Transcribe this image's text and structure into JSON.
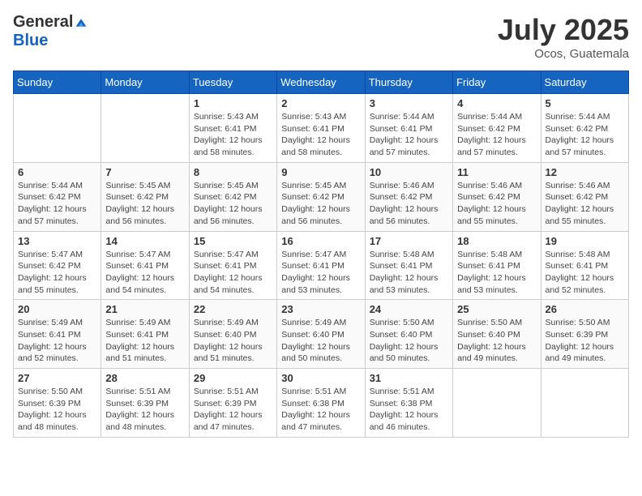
{
  "header": {
    "logo_general": "General",
    "logo_blue": "Blue",
    "month_title": "July 2025",
    "location": "Ocos, Guatemala"
  },
  "weekdays": [
    "Sunday",
    "Monday",
    "Tuesday",
    "Wednesday",
    "Thursday",
    "Friday",
    "Saturday"
  ],
  "weeks": [
    [
      {
        "day": "",
        "sunrise": "",
        "sunset": "",
        "daylight": ""
      },
      {
        "day": "",
        "sunrise": "",
        "sunset": "",
        "daylight": ""
      },
      {
        "day": "1",
        "sunrise": "Sunrise: 5:43 AM",
        "sunset": "Sunset: 6:41 PM",
        "daylight": "Daylight: 12 hours and 58 minutes."
      },
      {
        "day": "2",
        "sunrise": "Sunrise: 5:43 AM",
        "sunset": "Sunset: 6:41 PM",
        "daylight": "Daylight: 12 hours and 58 minutes."
      },
      {
        "day": "3",
        "sunrise": "Sunrise: 5:44 AM",
        "sunset": "Sunset: 6:41 PM",
        "daylight": "Daylight: 12 hours and 57 minutes."
      },
      {
        "day": "4",
        "sunrise": "Sunrise: 5:44 AM",
        "sunset": "Sunset: 6:42 PM",
        "daylight": "Daylight: 12 hours and 57 minutes."
      },
      {
        "day": "5",
        "sunrise": "Sunrise: 5:44 AM",
        "sunset": "Sunset: 6:42 PM",
        "daylight": "Daylight: 12 hours and 57 minutes."
      }
    ],
    [
      {
        "day": "6",
        "sunrise": "Sunrise: 5:44 AM",
        "sunset": "Sunset: 6:42 PM",
        "daylight": "Daylight: 12 hours and 57 minutes."
      },
      {
        "day": "7",
        "sunrise": "Sunrise: 5:45 AM",
        "sunset": "Sunset: 6:42 PM",
        "daylight": "Daylight: 12 hours and 56 minutes."
      },
      {
        "day": "8",
        "sunrise": "Sunrise: 5:45 AM",
        "sunset": "Sunset: 6:42 PM",
        "daylight": "Daylight: 12 hours and 56 minutes."
      },
      {
        "day": "9",
        "sunrise": "Sunrise: 5:45 AM",
        "sunset": "Sunset: 6:42 PM",
        "daylight": "Daylight: 12 hours and 56 minutes."
      },
      {
        "day": "10",
        "sunrise": "Sunrise: 5:46 AM",
        "sunset": "Sunset: 6:42 PM",
        "daylight": "Daylight: 12 hours and 56 minutes."
      },
      {
        "day": "11",
        "sunrise": "Sunrise: 5:46 AM",
        "sunset": "Sunset: 6:42 PM",
        "daylight": "Daylight: 12 hours and 55 minutes."
      },
      {
        "day": "12",
        "sunrise": "Sunrise: 5:46 AM",
        "sunset": "Sunset: 6:42 PM",
        "daylight": "Daylight: 12 hours and 55 minutes."
      }
    ],
    [
      {
        "day": "13",
        "sunrise": "Sunrise: 5:47 AM",
        "sunset": "Sunset: 6:42 PM",
        "daylight": "Daylight: 12 hours and 55 minutes."
      },
      {
        "day": "14",
        "sunrise": "Sunrise: 5:47 AM",
        "sunset": "Sunset: 6:41 PM",
        "daylight": "Daylight: 12 hours and 54 minutes."
      },
      {
        "day": "15",
        "sunrise": "Sunrise: 5:47 AM",
        "sunset": "Sunset: 6:41 PM",
        "daylight": "Daylight: 12 hours and 54 minutes."
      },
      {
        "day": "16",
        "sunrise": "Sunrise: 5:47 AM",
        "sunset": "Sunset: 6:41 PM",
        "daylight": "Daylight: 12 hours and 53 minutes."
      },
      {
        "day": "17",
        "sunrise": "Sunrise: 5:48 AM",
        "sunset": "Sunset: 6:41 PM",
        "daylight": "Daylight: 12 hours and 53 minutes."
      },
      {
        "day": "18",
        "sunrise": "Sunrise: 5:48 AM",
        "sunset": "Sunset: 6:41 PM",
        "daylight": "Daylight: 12 hours and 53 minutes."
      },
      {
        "day": "19",
        "sunrise": "Sunrise: 5:48 AM",
        "sunset": "Sunset: 6:41 PM",
        "daylight": "Daylight: 12 hours and 52 minutes."
      }
    ],
    [
      {
        "day": "20",
        "sunrise": "Sunrise: 5:49 AM",
        "sunset": "Sunset: 6:41 PM",
        "daylight": "Daylight: 12 hours and 52 minutes."
      },
      {
        "day": "21",
        "sunrise": "Sunrise: 5:49 AM",
        "sunset": "Sunset: 6:41 PM",
        "daylight": "Daylight: 12 hours and 51 minutes."
      },
      {
        "day": "22",
        "sunrise": "Sunrise: 5:49 AM",
        "sunset": "Sunset: 6:40 PM",
        "daylight": "Daylight: 12 hours and 51 minutes."
      },
      {
        "day": "23",
        "sunrise": "Sunrise: 5:49 AM",
        "sunset": "Sunset: 6:40 PM",
        "daylight": "Daylight: 12 hours and 50 minutes."
      },
      {
        "day": "24",
        "sunrise": "Sunrise: 5:50 AM",
        "sunset": "Sunset: 6:40 PM",
        "daylight": "Daylight: 12 hours and 50 minutes."
      },
      {
        "day": "25",
        "sunrise": "Sunrise: 5:50 AM",
        "sunset": "Sunset: 6:40 PM",
        "daylight": "Daylight: 12 hours and 49 minutes."
      },
      {
        "day": "26",
        "sunrise": "Sunrise: 5:50 AM",
        "sunset": "Sunset: 6:39 PM",
        "daylight": "Daylight: 12 hours and 49 minutes."
      }
    ],
    [
      {
        "day": "27",
        "sunrise": "Sunrise: 5:50 AM",
        "sunset": "Sunset: 6:39 PM",
        "daylight": "Daylight: 12 hours and 48 minutes."
      },
      {
        "day": "28",
        "sunrise": "Sunrise: 5:51 AM",
        "sunset": "Sunset: 6:39 PM",
        "daylight": "Daylight: 12 hours and 48 minutes."
      },
      {
        "day": "29",
        "sunrise": "Sunrise: 5:51 AM",
        "sunset": "Sunset: 6:39 PM",
        "daylight": "Daylight: 12 hours and 47 minutes."
      },
      {
        "day": "30",
        "sunrise": "Sunrise: 5:51 AM",
        "sunset": "Sunset: 6:38 PM",
        "daylight": "Daylight: 12 hours and 47 minutes."
      },
      {
        "day": "31",
        "sunrise": "Sunrise: 5:51 AM",
        "sunset": "Sunset: 6:38 PM",
        "daylight": "Daylight: 12 hours and 46 minutes."
      },
      {
        "day": "",
        "sunrise": "",
        "sunset": "",
        "daylight": ""
      },
      {
        "day": "",
        "sunrise": "",
        "sunset": "",
        "daylight": ""
      }
    ]
  ]
}
